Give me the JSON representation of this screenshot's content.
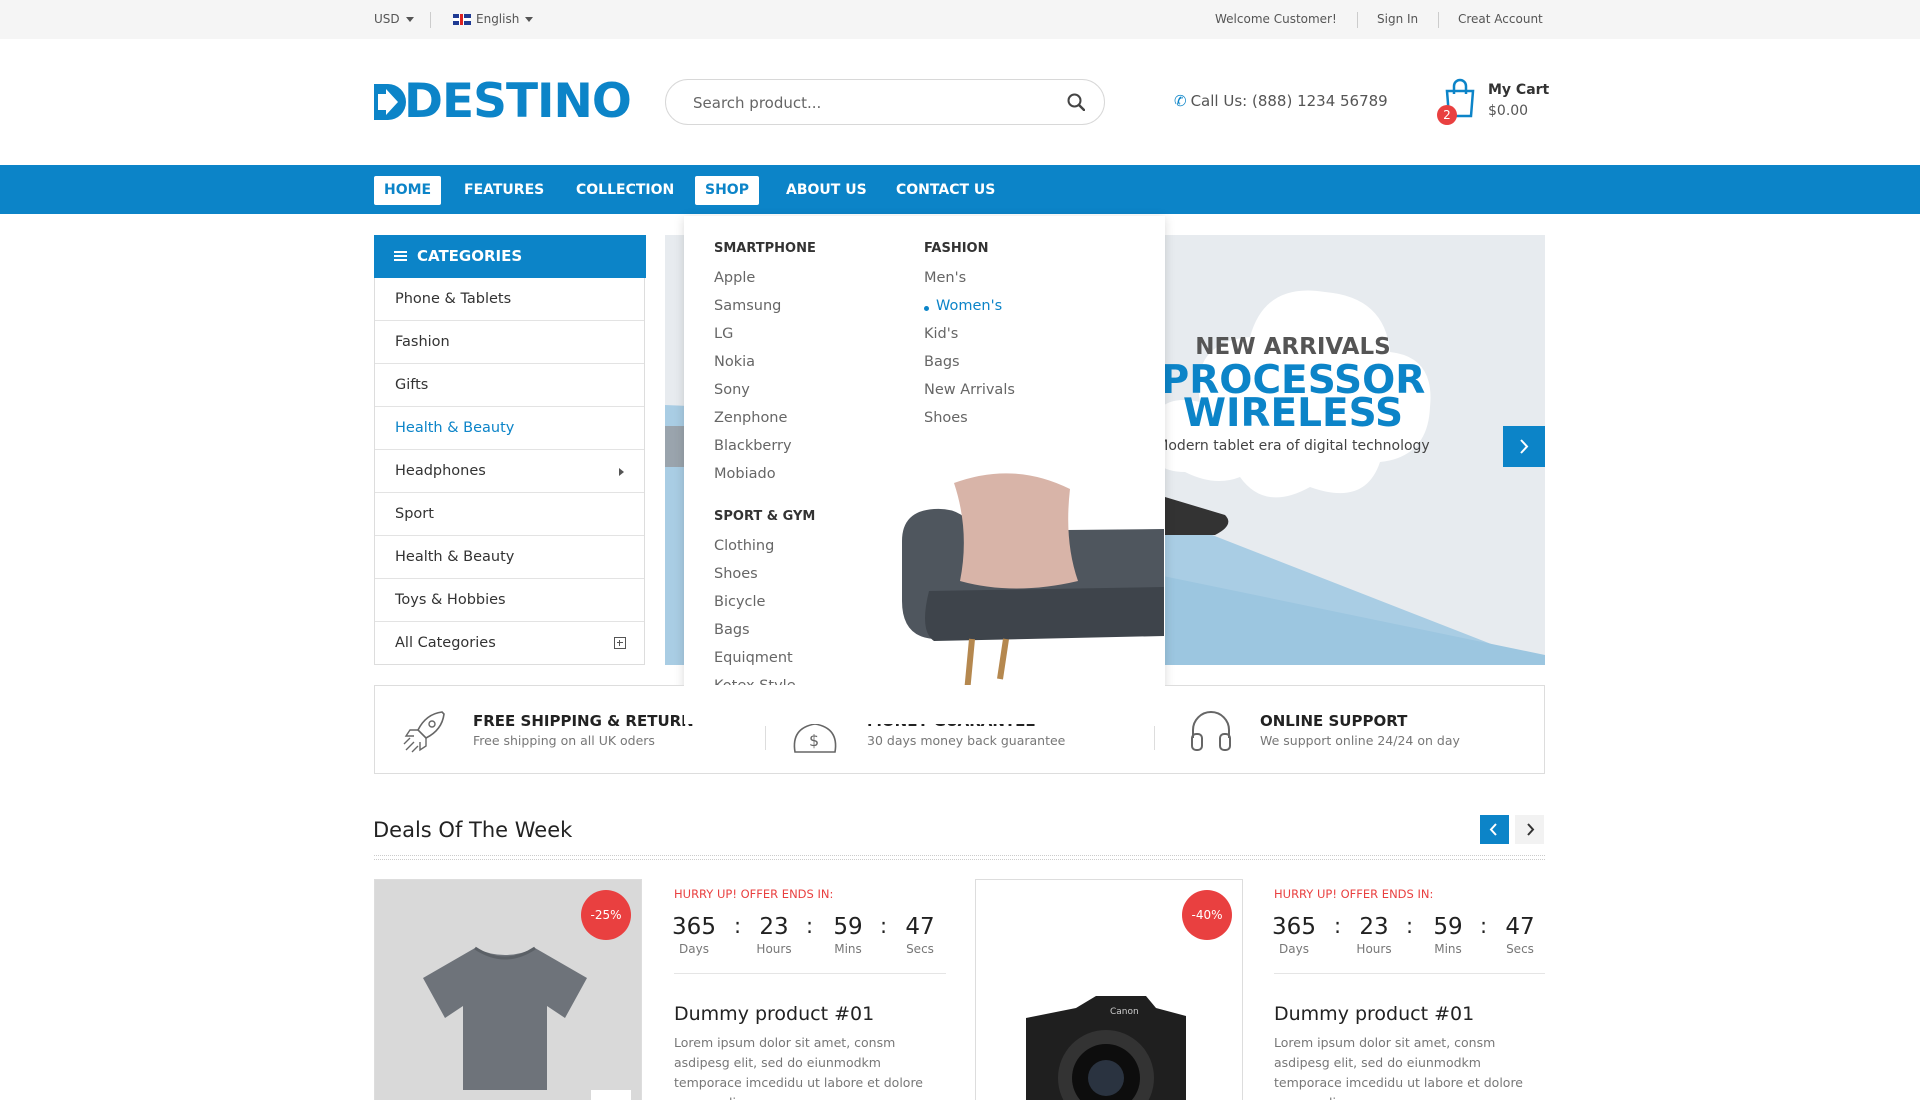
{
  "topbar": {
    "currency": "USD",
    "language": "English",
    "welcome": "Welcome Customer!",
    "sign_in": "Sign In",
    "create_account": "Creat Account"
  },
  "header": {
    "logo": "DESTINO",
    "search_placeholder": "Search product...",
    "phone": "Call Us: (888) 1234 56789",
    "cart_title": "My Cart",
    "cart_total": "$0.00",
    "cart_count": "2"
  },
  "nav": {
    "items": [
      "HOME",
      "FEATURES",
      "COLLECTION",
      "SHOP",
      "ABOUT US",
      "CONTACT US"
    ]
  },
  "categories": {
    "title": "CATEGORIES",
    "items": [
      "Phone & Tablets",
      "Fashion",
      "Gifts",
      "Health & Beauty",
      "Headphones",
      "Sport",
      "Health & Beauty",
      "Toys & Hobbies",
      "All Categories"
    ]
  },
  "mega_menu": {
    "smartphone": {
      "title": "SMARTPHONE",
      "items": [
        "Apple",
        "Samsung",
        "LG",
        "Nokia",
        "Sony",
        "Zenphone",
        "Blackberry",
        "Mobiado"
      ]
    },
    "sport_gym": {
      "title": "SPORT & GYM",
      "items": [
        "Clothing",
        "Shoes",
        "Bicycle",
        "Bags",
        "Equiqment",
        "Kotex Style"
      ]
    },
    "fashion": {
      "title": "FASHION",
      "items": [
        "Men's",
        "Women's",
        "Kid's",
        "Bags",
        "New Arrivals",
        "Shoes"
      ]
    }
  },
  "slider": {
    "subtitle": "NEW ARRIVALS",
    "title": "PROCESSOR WIRELESS",
    "description": "Modern tablet era of digital technology"
  },
  "services": [
    {
      "title": "FREE SHIPPING & RETURN",
      "desc": "Free shipping on all UK oders"
    },
    {
      "title": "MONEY GUARANTEE",
      "desc": "30 days money back guarantee"
    },
    {
      "title": "ONLINE SUPPORT",
      "desc": "We support online 24/24 on day"
    }
  ],
  "deals": {
    "title": "Deals Of The Week",
    "products": [
      {
        "discount": "-25%",
        "hurry": "HURRY UP! OFFER ENDS IN:",
        "countdown": {
          "days": "365",
          "hours": "23",
          "mins": "59",
          "secs": "47"
        },
        "labels": {
          "days": "Days",
          "hours": "Hours",
          "mins": "Mins",
          "secs": "Secs"
        },
        "name": "Dummy product #01",
        "desc": "Lorem ipsum dolor sit amet, consm asdipesg elit, sed do eiunmodkm temporace imcedidu ut labore et dolore magna aliqua..."
      },
      {
        "discount": "-40%",
        "hurry": "HURRY UP! OFFER ENDS IN:",
        "countdown": {
          "days": "365",
          "hours": "23",
          "mins": "59",
          "secs": "47"
        },
        "labels": {
          "days": "Days",
          "hours": "Hours",
          "mins": "Mins",
          "secs": "Secs"
        },
        "name": "Dummy product #01",
        "desc": "Lorem ipsum dolor sit amet, consm asdipesg elit, sed do eiunmodkm temporace imcedidu ut labore et dolore magna aliqua..."
      }
    ]
  },
  "colors": {
    "brand": "#0c84c8",
    "sale": "#e94040"
  }
}
